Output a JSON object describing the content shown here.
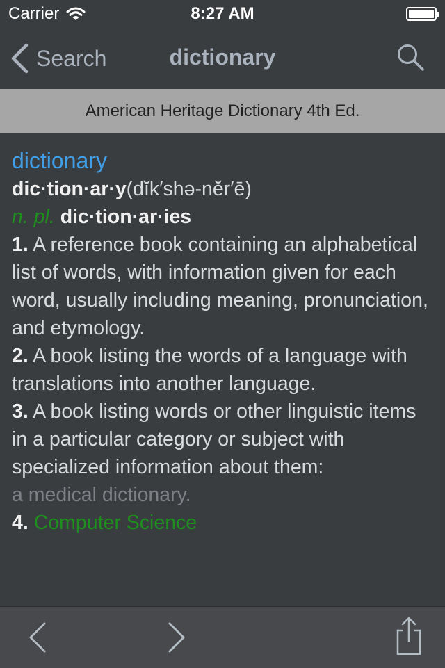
{
  "status_bar": {
    "carrier": "Carrier",
    "time": "8:27 AM"
  },
  "nav": {
    "back_label": "Search",
    "title": "dictionary"
  },
  "source": {
    "name": "American Heritage Dictionary 4th Ed."
  },
  "entry": {
    "headword": "dictionary",
    "syllabified": "dic·tion·ar·y",
    "pronunciation": "(dĭk′shə-nĕr′ē)",
    "pos": "n. pl.",
    "plural": "dic·tion·ar·ies",
    "senses": [
      {
        "num": "1.",
        "text": " A reference book containing an alphabetical list of words, with information given for each word, usually including meaning, pronunciation, and etymology."
      },
      {
        "num": "2.",
        "text": " A book listing the words of a language with translations into another language."
      },
      {
        "num": "3.",
        "text": " A book listing words or other linguistic items in a particular category or subject with specialized information about them:",
        "example": "a medical dictionary."
      },
      {
        "num": "4.",
        "field": " Computer Science"
      }
    ]
  },
  "colors": {
    "background": "#3a3d40",
    "headword": "#3f9ee6",
    "pos": "#1e8f1e",
    "source_bar": "#a6a6a6",
    "nav_text": "#aab3bd"
  },
  "icons": {
    "back": "chevron-left-icon",
    "search": "search-icon",
    "prev": "chevron-left-icon",
    "next": "chevron-right-icon",
    "share": "share-icon",
    "wifi": "wifi-icon",
    "battery": "battery-icon"
  }
}
